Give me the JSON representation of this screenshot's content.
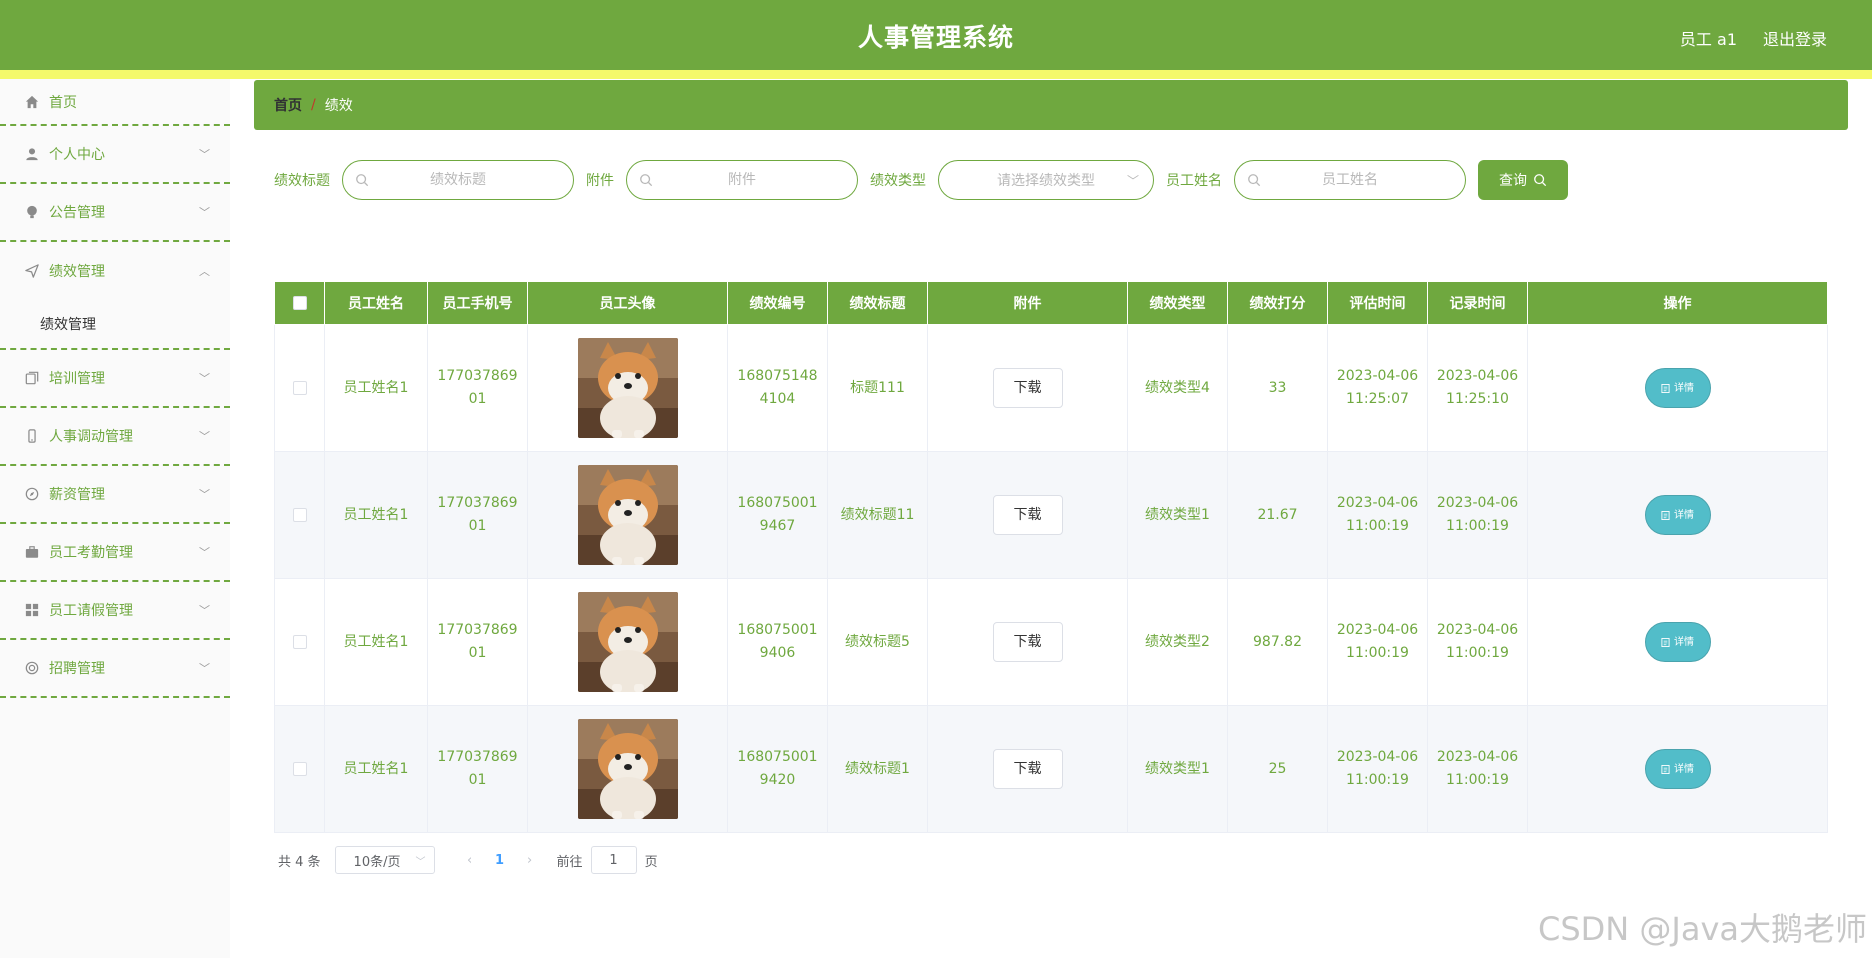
{
  "header": {
    "title": "人事管理系统",
    "user": "员工 a1",
    "logout": "退出登录"
  },
  "sidebar": {
    "items": [
      {
        "label": "首页",
        "icon": "home-icon"
      },
      {
        "label": "个人中心",
        "icon": "user-icon"
      },
      {
        "label": "公告管理",
        "icon": "bulb-icon"
      },
      {
        "label": "绩效管理",
        "icon": "send-icon"
      },
      {
        "label": "培训管理",
        "icon": "copy-icon"
      },
      {
        "label": "人事调动管理",
        "icon": "phone-icon"
      },
      {
        "label": "薪资管理",
        "icon": "compass-icon"
      },
      {
        "label": "员工考勤管理",
        "icon": "briefcase-icon"
      },
      {
        "label": "员工请假管理",
        "icon": "grid-icon"
      },
      {
        "label": "招聘管理",
        "icon": "help-icon"
      }
    ],
    "submenu": "绩效管理"
  },
  "breadcrumb": {
    "home": "首页",
    "separator": "/",
    "current": "绩效"
  },
  "search": {
    "title_label": "绩效标题",
    "title_placeholder": "绩效标题",
    "attach_label": "附件",
    "attach_placeholder": "附件",
    "type_label": "绩效类型",
    "type_placeholder": "请选择绩效类型",
    "name_label": "员工姓名",
    "name_placeholder": "员工姓名",
    "query": "查询"
  },
  "table": {
    "headers": [
      "员工姓名",
      "员工手机号",
      "员工头像",
      "绩效编号",
      "绩效标题",
      "附件",
      "绩效类型",
      "绩效打分",
      "评估时间",
      "记录时间",
      "操作"
    ],
    "rows": [
      {
        "name": "员工姓名1",
        "phone": [
          "177037869",
          "01"
        ],
        "code": [
          "168075148",
          "4104"
        ],
        "title": "标题111",
        "attach": "下载",
        "type": "绩效类型4",
        "score": "33",
        "eval_time": [
          "2023-04-06",
          "11:25:07"
        ],
        "record_time": [
          "2023-04-06",
          "11:25:10"
        ],
        "action": "详情"
      },
      {
        "name": "员工姓名1",
        "phone": [
          "177037869",
          "01"
        ],
        "code": [
          "168075001",
          "9467"
        ],
        "title": "绩效标题11",
        "attach": "下载",
        "type": "绩效类型1",
        "score": "21.67",
        "eval_time": [
          "2023-04-06",
          "11:00:19"
        ],
        "record_time": [
          "2023-04-06",
          "11:00:19"
        ],
        "action": "详情"
      },
      {
        "name": "员工姓名1",
        "phone": [
          "177037869",
          "01"
        ],
        "code": [
          "168075001",
          "9406"
        ],
        "title": "绩效标题5",
        "attach": "下载",
        "type": "绩效类型2",
        "score": "987.82",
        "eval_time": [
          "2023-04-06",
          "11:00:19"
        ],
        "record_time": [
          "2023-04-06",
          "11:00:19"
        ],
        "action": "详情"
      },
      {
        "name": "员工姓名1",
        "phone": [
          "177037869",
          "01"
        ],
        "code": [
          "168075001",
          "9420"
        ],
        "title": "绩效标题1",
        "attach": "下载",
        "type": "绩效类型1",
        "score": "25",
        "eval_time": [
          "2023-04-06",
          "11:00:19"
        ],
        "record_time": [
          "2023-04-06",
          "11:00:19"
        ],
        "action": "详情"
      }
    ]
  },
  "pagination": {
    "total": "共 4 条",
    "page_size": "10条/页",
    "current": "1",
    "goto_prefix": "前往",
    "goto_value": "1",
    "goto_suffix": "页"
  },
  "watermark": "CSDN @Java大鹅老师",
  "colors": {
    "primary": "#6fa83f",
    "stripe": "#f4f96b",
    "detail": "#52bdc9"
  }
}
